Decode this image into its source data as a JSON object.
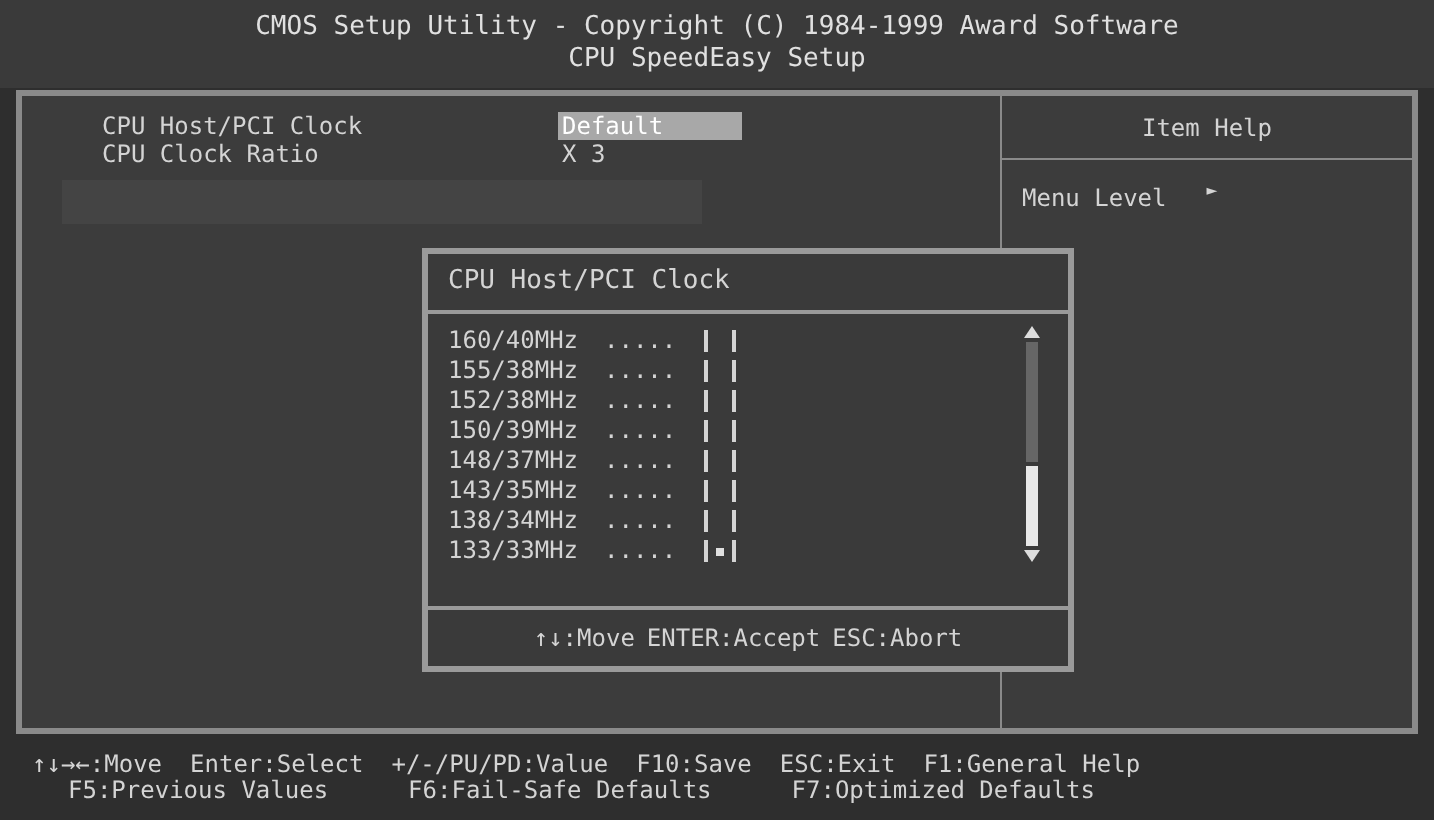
{
  "header": {
    "title": "CMOS Setup Utility - Copyright (C) 1984-1999 Award Software",
    "subtitle": "CPU SpeedEasy Setup"
  },
  "fields": [
    {
      "label": "CPU Host/PCI Clock",
      "value": "Default",
      "selected": true
    },
    {
      "label": "CPU Clock Ratio",
      "value": "X 3",
      "selected": false
    }
  ],
  "help": {
    "title": "Item Help",
    "menu_level": "Menu Level",
    "menu_level_marker": "►"
  },
  "popup": {
    "title": "CPU Host/PCI Clock",
    "options": [
      {
        "label": "160/40MHz",
        "leader": ".....",
        "selected": false
      },
      {
        "label": "155/38MHz",
        "leader": ".....",
        "selected": false
      },
      {
        "label": "152/38MHz",
        "leader": ".....",
        "selected": false
      },
      {
        "label": "150/39MHz",
        "leader": ".....",
        "selected": false
      },
      {
        "label": "148/37MHz",
        "leader": ".....",
        "selected": false
      },
      {
        "label": "143/35MHz",
        "leader": ".....",
        "selected": false
      },
      {
        "label": "138/34MHz",
        "leader": ".....",
        "selected": false
      },
      {
        "label": "133/33MHz",
        "leader": ".....",
        "selected": true
      }
    ],
    "hints": [
      "↑↓:Move",
      "ENTER:Accept",
      "ESC:Abort"
    ]
  },
  "status_bar": {
    "line_1": [
      "↑↓→←:Move",
      "Enter:Select",
      "+/-/PU/PD:Value",
      "F10:Save",
      "ESC:Exit",
      "F1:General Help"
    ],
    "line_2": [
      "F5:Previous Values",
      "F6:Fail-Safe Defaults",
      "F7:Optimized Defaults"
    ]
  }
}
